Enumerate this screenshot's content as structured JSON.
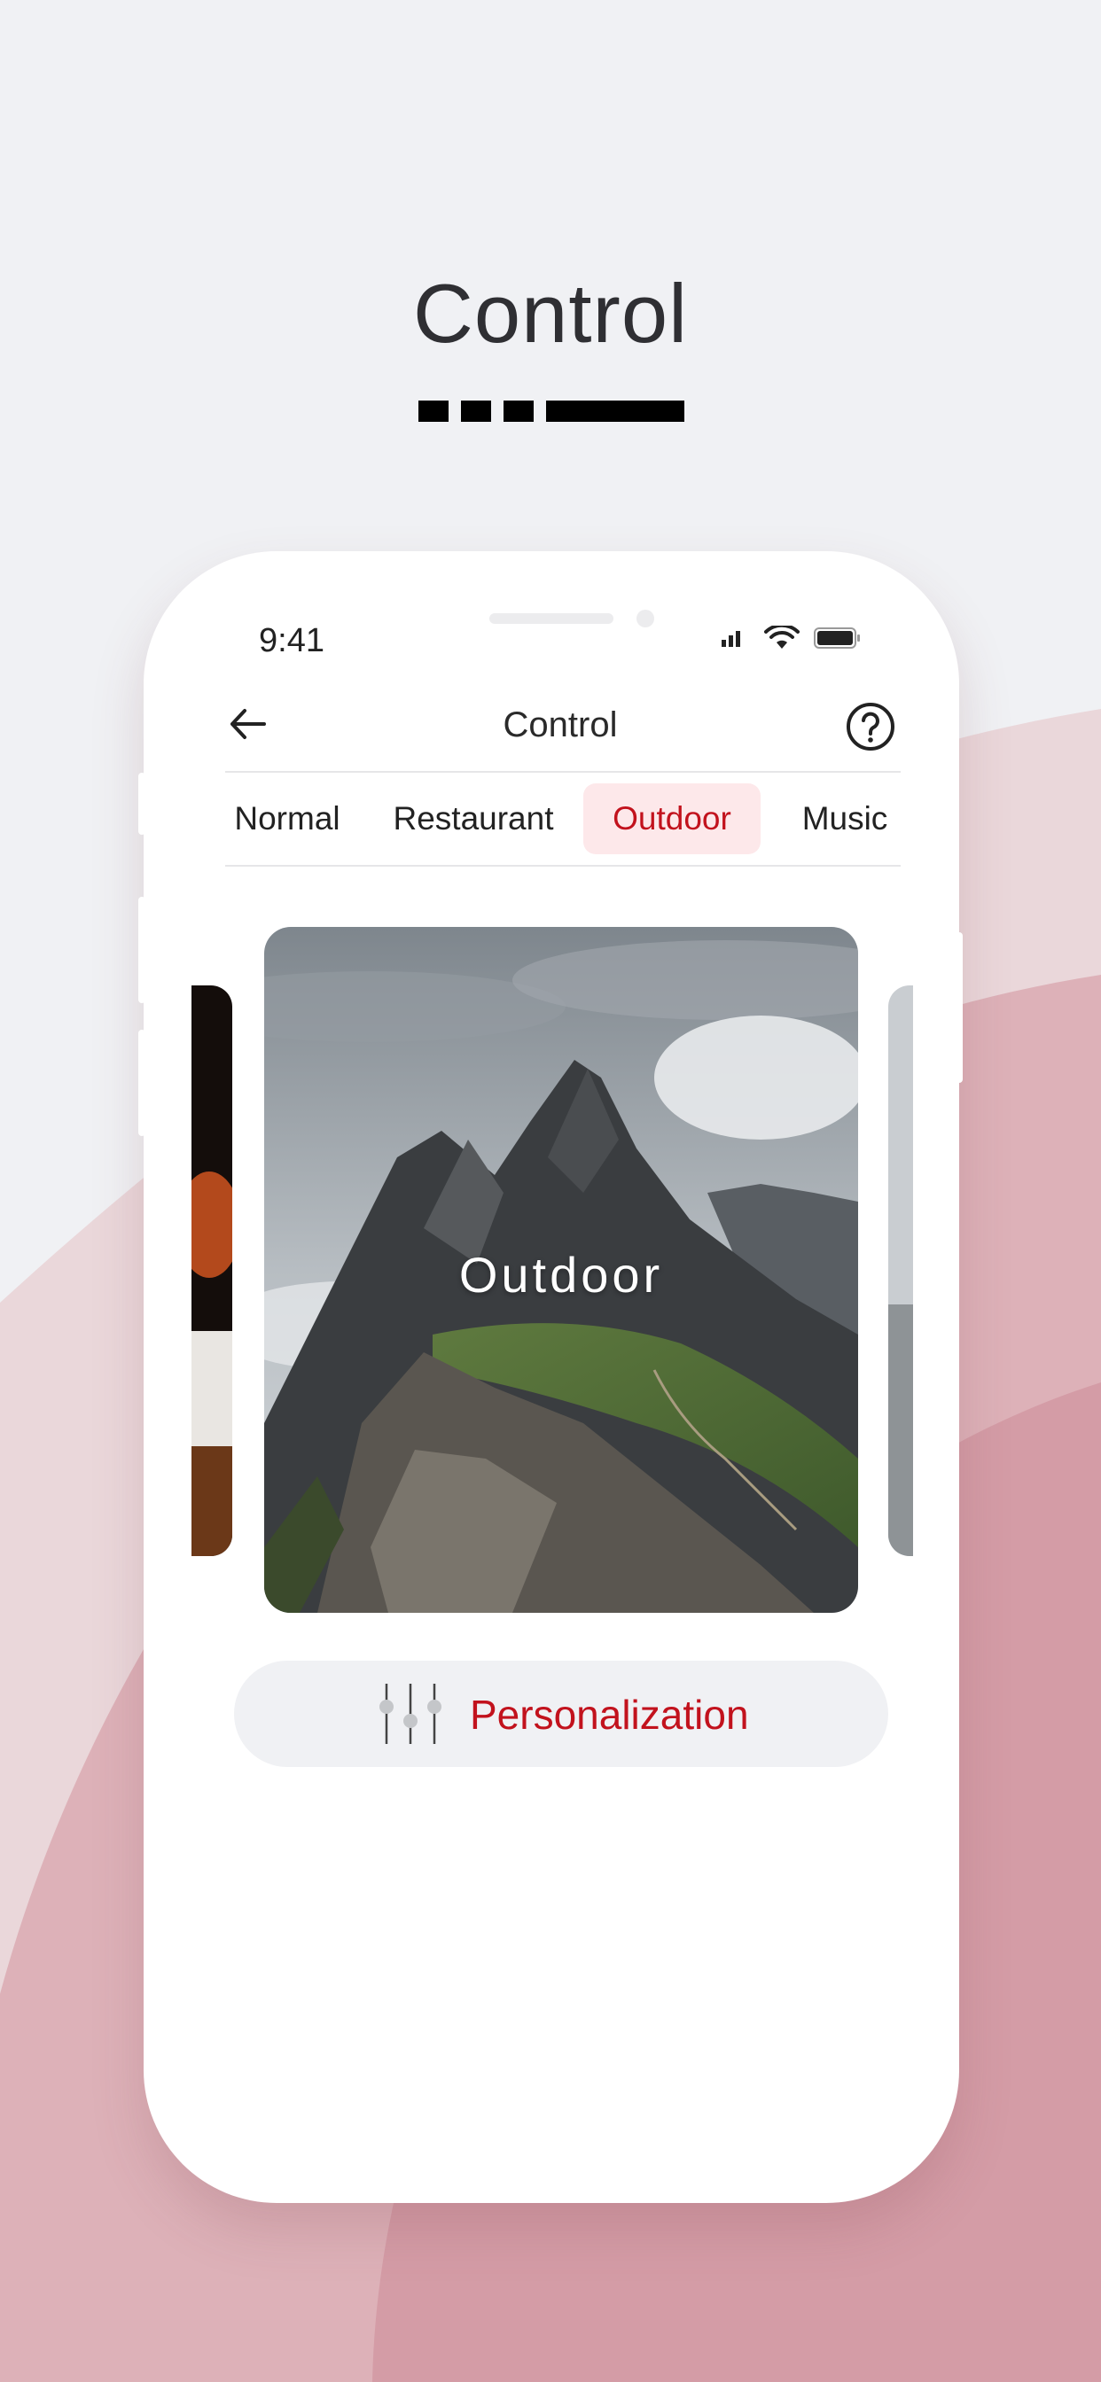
{
  "page": {
    "title": "Control"
  },
  "status_bar": {
    "time": "9:41",
    "icons": [
      "signal-icon",
      "wifi-icon",
      "battery-icon"
    ]
  },
  "nav": {
    "title": "Control",
    "back_icon": "arrow-left-icon",
    "help_icon": "question-circle-icon"
  },
  "tabs": [
    {
      "label": "Normal",
      "active": false
    },
    {
      "label": "Restaurant",
      "active": false
    },
    {
      "label": "Outdoor",
      "active": true
    },
    {
      "label": "Music",
      "active": false
    }
  ],
  "carousel": {
    "current": {
      "label": "Outdoor"
    }
  },
  "personalization": {
    "label": "Personalization",
    "icon": "sliders-icon"
  },
  "colors": {
    "accent": "#c2121d",
    "accent_soft": "#fde8ea",
    "background": "#f0f1f4",
    "brand_pink": "#d6a0aa"
  }
}
